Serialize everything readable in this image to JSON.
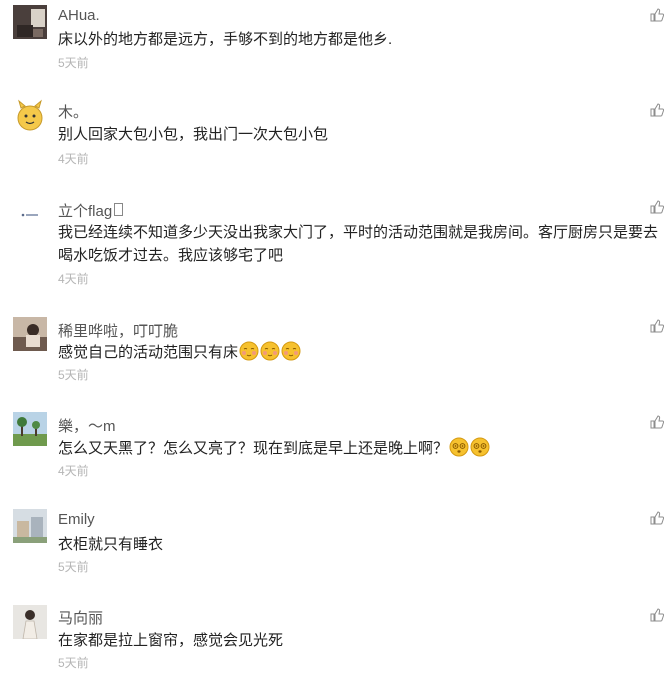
{
  "comments": [
    {
      "name": "AHua.",
      "text": "床以外的地方都是远方，手够不到的地方都是他乡.",
      "time": "5天前",
      "avatar": "avatar-dark-room-icon"
    },
    {
      "name": "木。",
      "text": "别人回家大包小包，我出门一次大包小包",
      "time": "4天前",
      "avatar": "avatar-cartoon-face-icon"
    },
    {
      "name": "立个flag",
      "text": "我已经连续不知道多少天没出我家大门了，平时的活动范围就是我房间。客厅厨房只是要去喝水吃饭才过去。我应该够宅了吧",
      "time": "4天前",
      "avatar": "avatar-small-logo-icon"
    },
    {
      "name": "稀里哗啦，叮叮脆",
      "text": "感觉自己的活动范围只有床",
      "time": "5天前",
      "avatar": "avatar-photo-icon"
    },
    {
      "name": "樂，～m",
      "text": "怎么又天黑了？怎么又亮了？现在到底是早上还是晚上啊？",
      "time": "4天前",
      "avatar": "avatar-landscape-icon"
    },
    {
      "name": "Emily",
      "text": "衣柜就只有睡衣",
      "time": "5天前",
      "avatar": "avatar-building-icon"
    },
    {
      "name": "马向丽",
      "text": "在家都是拉上窗帘，感觉会见光死",
      "time": "5天前",
      "avatar": "avatar-person-icon"
    }
  ],
  "icons": {
    "like": "thumbs-up-icon",
    "emoji_blush": "blushing-face-emoji-icon",
    "emoji_dizzy": "dizzy-face-emoji-icon"
  },
  "colors": {
    "name": "#555555",
    "text": "#222222",
    "time": "#b5b5b5",
    "like_icon": "#8c8c8c",
    "emoji_yellow": "#f6c12e"
  }
}
